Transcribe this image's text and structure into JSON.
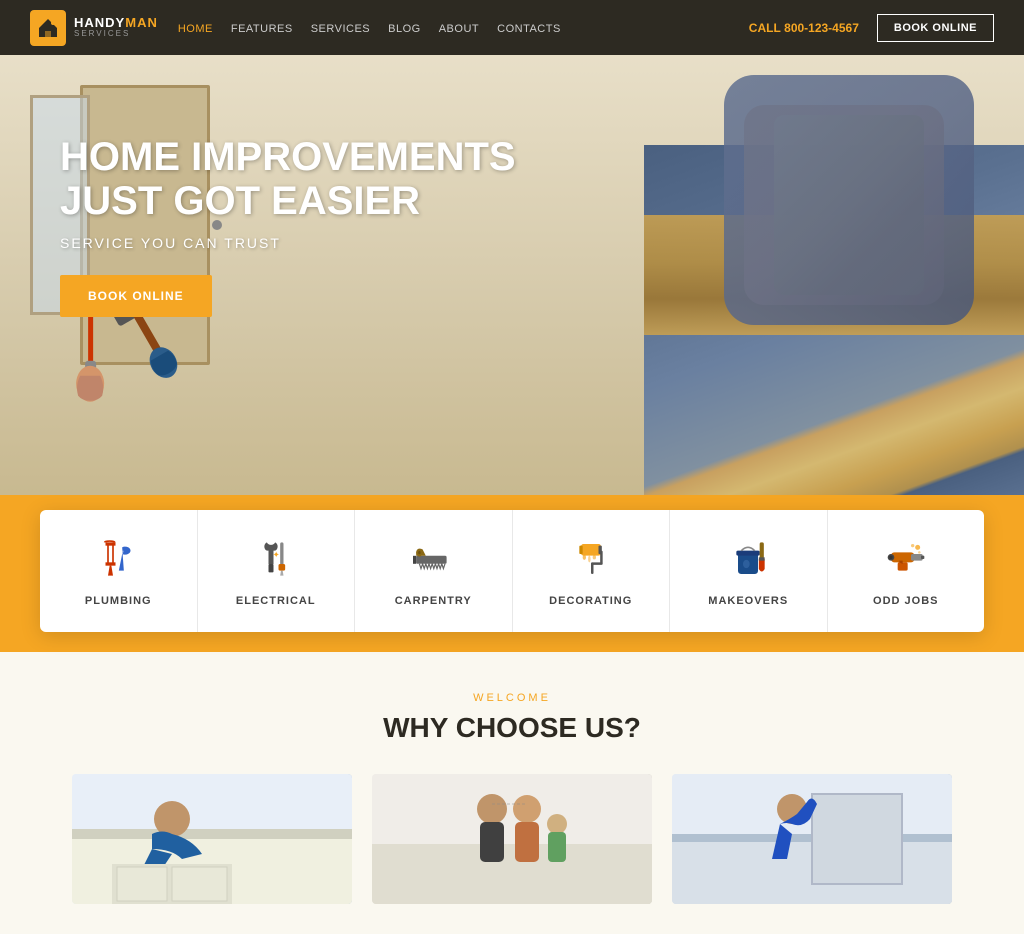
{
  "navbar": {
    "logo": {
      "brand1": "HANDY",
      "brand2": "MAN",
      "tagline": "SERVICES"
    },
    "nav_links": [
      {
        "label": "HOME",
        "active": true
      },
      {
        "label": "FEATURES",
        "active": false
      },
      {
        "label": "SERVICES",
        "active": false
      },
      {
        "label": "BLOG",
        "active": false
      },
      {
        "label": "ABOUT",
        "active": false
      },
      {
        "label": "CONTACTS",
        "active": false
      }
    ],
    "call_label": "CALL",
    "phone": "800-123-4567",
    "book_online": "BOOK ONLINE"
  },
  "hero": {
    "title_line1": "HOME IMPROVEMENTS",
    "title_line2": "JUST GOT EASIER",
    "subtitle": "SERVICE YOU CAN TRUST",
    "book_btn": "BOOK ONLINE"
  },
  "services": [
    {
      "label": "PLUMBING",
      "icon": "plumbing"
    },
    {
      "label": "ELECTRICAL",
      "icon": "electrical"
    },
    {
      "label": "CARPENTRY",
      "icon": "carpentry"
    },
    {
      "label": "DECORATING",
      "icon": "decorating"
    },
    {
      "label": "MAKEOVERS",
      "icon": "makeovers"
    },
    {
      "label": "ODD JOBS",
      "icon": "oddjobs"
    }
  ],
  "why_section": {
    "welcome_label": "Welcome",
    "title": "WHY CHOOSE US?",
    "cards": [
      {
        "alt": "Kitchen worker"
      },
      {
        "alt": "Consultation"
      },
      {
        "alt": "Installation"
      }
    ]
  },
  "colors": {
    "accent": "#f5a623",
    "dark": "#2d2a22",
    "white": "#ffffff"
  }
}
